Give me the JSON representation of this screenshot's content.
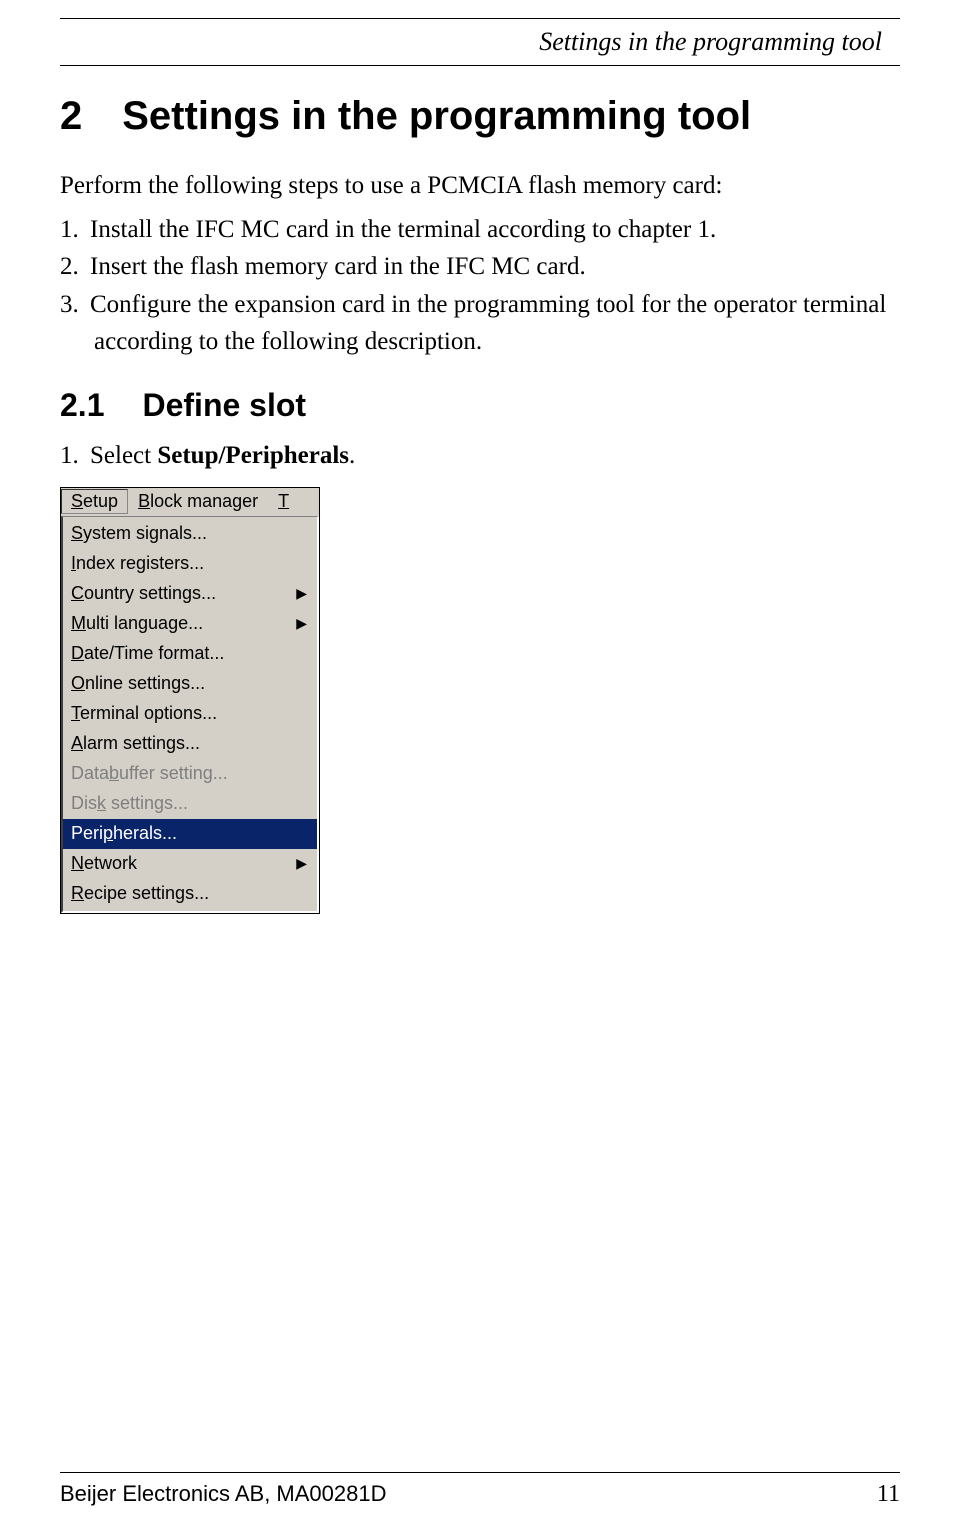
{
  "header": {
    "title": "Settings in the programming tool"
  },
  "section": {
    "number": "2",
    "title": "Settings in the programming tool",
    "intro": "Perform the following steps to use a PCMCIA flash memory card:",
    "steps": [
      {
        "n": "1.",
        "text": "Install the IFC MC card in the terminal according to chapter 1."
      },
      {
        "n": "2.",
        "text": "Insert the flash memory card in the IFC MC card."
      },
      {
        "n": "3.",
        "text": "Configure the expansion card in the programming tool for the operator terminal according to the following description."
      }
    ]
  },
  "subsection": {
    "number": "2.1",
    "title": "Define slot",
    "step": {
      "n": "1.",
      "prefix": "Select ",
      "bold": "Setup/Peripherals",
      "suffix": "."
    }
  },
  "menu": {
    "menubar": [
      {
        "ul": "S",
        "rest": "etup",
        "active": true
      },
      {
        "ul": "B",
        "rest": "lock manager",
        "active": false
      },
      {
        "ul": "T",
        "rest": "",
        "active": false,
        "truncated": true
      }
    ],
    "items": [
      {
        "ul": "S",
        "rest": "ystem signals...",
        "submenu": false,
        "disabled": false,
        "highlighted": false
      },
      {
        "ul": "I",
        "rest": "ndex registers...",
        "submenu": false,
        "disabled": false,
        "highlighted": false
      },
      {
        "ul": "C",
        "rest": "ountry settings...",
        "submenu": true,
        "disabled": false,
        "highlighted": false
      },
      {
        "ul": "M",
        "rest": "ulti language...",
        "submenu": true,
        "disabled": false,
        "highlighted": false
      },
      {
        "ul": "D",
        "rest": "ate/Time format...",
        "submenu": false,
        "disabled": false,
        "highlighted": false
      },
      {
        "ul": "O",
        "rest": "nline settings...",
        "submenu": false,
        "disabled": false,
        "highlighted": false
      },
      {
        "ul": "T",
        "rest": "erminal options...",
        "submenu": false,
        "disabled": false,
        "highlighted": false
      },
      {
        "ul": "A",
        "rest": "larm settings...",
        "submenu": false,
        "disabled": false,
        "highlighted": false
      },
      {
        "pre": "Data",
        "ul": "b",
        "rest": "uffer setting...",
        "submenu": false,
        "disabled": true,
        "highlighted": false
      },
      {
        "pre": "Dis",
        "ul": "k",
        "rest": " settings...",
        "submenu": false,
        "disabled": true,
        "highlighted": false
      },
      {
        "pre": "Peri",
        "ul": "p",
        "rest": "herals...",
        "submenu": false,
        "disabled": false,
        "highlighted": true
      },
      {
        "ul": "N",
        "rest": "etwork",
        "submenu": true,
        "disabled": false,
        "highlighted": false
      },
      {
        "ul": "R",
        "rest": "ecipe settings...",
        "submenu": false,
        "disabled": false,
        "highlighted": false
      }
    ]
  },
  "footer": {
    "left": "Beijer Electronics AB, MA00281D",
    "right": "11"
  }
}
